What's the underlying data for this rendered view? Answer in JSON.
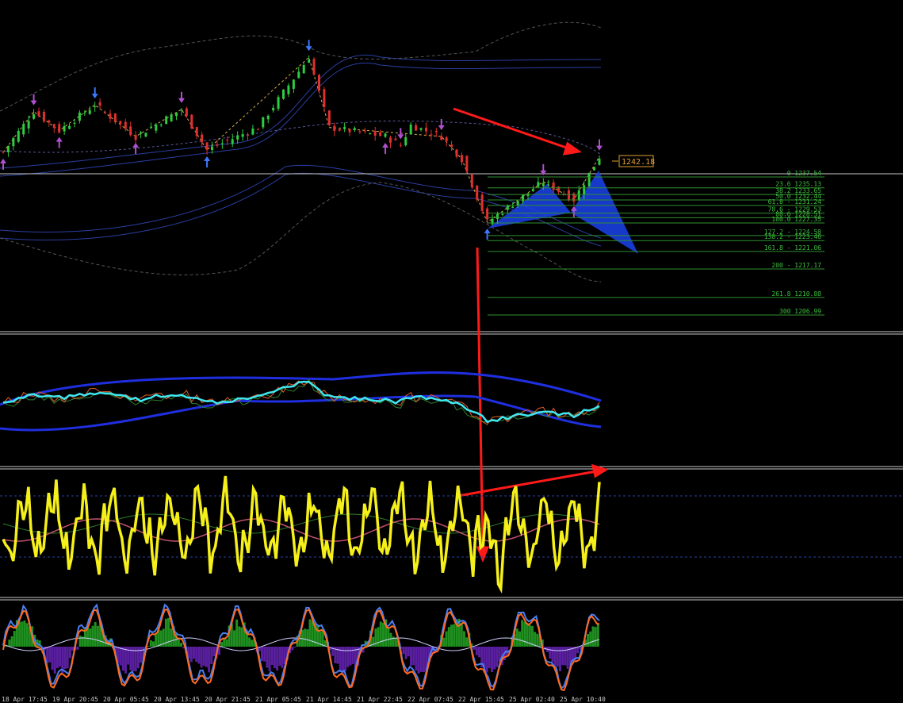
{
  "chart_data": {
    "type": "candlestick",
    "price_tag": "1242.18",
    "fib_levels": [
      {
        "label": "0 1237.54",
        "price": 1237.54
      },
      {
        "label": "23.6 1235.13",
        "price": 1235.13
      },
      {
        "label": "38.2 1233.65",
        "price": 1233.65
      },
      {
        "label": "50.0 1232.44",
        "price": 1232.44
      },
      {
        "label": "61.8 - 1231.24",
        "price": 1231.24
      },
      {
        "label": "78.6 - 1229.53",
        "price": 1229.53
      },
      {
        "label": "88.6 1228.51",
        "price": 1228.51
      },
      {
        "label": "100.0 1227.35",
        "price": 1227.35
      },
      {
        "label": "127.2 - 1224.58",
        "price": 1224.58
      },
      {
        "label": "138.2 - 1223.46",
        "price": 1223.46
      },
      {
        "label": "161.8 - 1221.06",
        "price": 1221.06
      },
      {
        "label": "200 - 1217.17",
        "price": 1217.17
      },
      {
        "label": "261.8 1210.88",
        "price": 1210.88
      },
      {
        "label": "300 1206.99",
        "price": 1206.99
      }
    ],
    "time_labels": [
      "18 Apr 17:45",
      "19 Apr 20:45",
      "20 Apr 05:45",
      "20 Apr 13:45",
      "20 Apr 21:45",
      "21 Apr 05:45",
      "21 Apr 14:45",
      "21 Apr 22:45",
      "22 Apr 07:45",
      "22 Apr 15:45",
      "25 Apr 02:40",
      "25 Apr 10:40"
    ],
    "price_points": [
      {
        "i": 0,
        "p": 1243.0
      },
      {
        "i": 6,
        "p": 1252.0
      },
      {
        "i": 11,
        "p": 1247.8
      },
      {
        "i": 18,
        "p": 1253.5
      },
      {
        "i": 26,
        "p": 1246.5
      },
      {
        "i": 35,
        "p": 1252.5
      },
      {
        "i": 40,
        "p": 1243.5
      },
      {
        "i": 50,
        "p": 1248.5
      },
      {
        "i": 60,
        "p": 1264.0
      },
      {
        "i": 64,
        "p": 1248.5
      },
      {
        "i": 75,
        "p": 1246.5
      },
      {
        "i": 78,
        "p": 1244.5
      },
      {
        "i": 80,
        "p": 1249.0
      },
      {
        "i": 86,
        "p": 1246.5
      },
      {
        "i": 90,
        "p": 1241.5
      },
      {
        "i": 95,
        "p": 1227.5
      },
      {
        "i": 106,
        "p": 1236.5
      },
      {
        "i": 112,
        "p": 1232.5
      },
      {
        "i": 117,
        "p": 1242.0
      }
    ]
  }
}
